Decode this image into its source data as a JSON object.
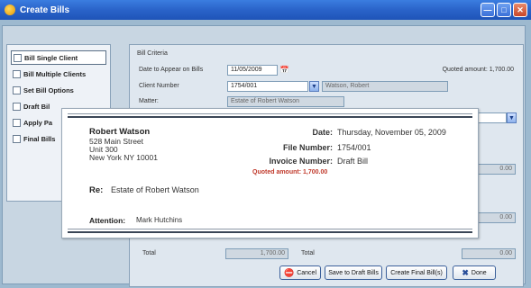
{
  "window": {
    "title": "Create Bills"
  },
  "nav": {
    "items": [
      {
        "label": "Bill Single Client",
        "active": true
      },
      {
        "label": "Bill Multiple Clients",
        "active": false
      },
      {
        "label": "Set Bill Options",
        "active": false
      },
      {
        "label": "Draft Bil",
        "active": false
      },
      {
        "label": "Apply Pa",
        "active": false
      },
      {
        "label": "Final Bills",
        "active": false
      }
    ]
  },
  "form": {
    "group_label": "Bill Criteria",
    "date_label": "Date to Appear on Bills",
    "date_value": "11/05/2009",
    "client_label": "Client Number",
    "client_value": "1754/001",
    "client_name": "Watson, Robert",
    "quoted_label": "Quoted amount:",
    "quoted_value": "1,700.00",
    "matter_label": "Matter:",
    "matter_value": "Estate of Robert Watson",
    "amount_1": "0.00",
    "amount_2": "0.00",
    "total_label_left": "Total",
    "total_value_left": "1,700.00",
    "total_label_right": "Total",
    "total_value_right": "0.00"
  },
  "buttons": {
    "cancel": "Cancel",
    "save_draft": "Save to Draft Bills",
    "create_final": "Create Final Bill(s)",
    "done": "Done"
  },
  "popup": {
    "name": "Robert Watson",
    "address_line1": "528 Main Street",
    "address_line2": "Unit 300",
    "address_line3": "New York NY 10001",
    "date_label": "Date:",
    "date_value": "Thursday, November 05, 2009",
    "file_label": "File Number:",
    "file_value": "1754/001",
    "invoice_label": "Invoice Number:",
    "invoice_value": "Draft Bill",
    "quoted": "Quoted amount: 1,700.00",
    "re_label": "Re:",
    "re_value": "Estate of Robert Watson",
    "attention_label": "Attention:",
    "attention_value": "Mark Hutchins"
  },
  "colors": {
    "title_bar": "#2a63c9",
    "quoted_text": "#c0392b",
    "client_bg": "#9db9cf"
  },
  "icons": {
    "app": "app-logo-icon",
    "calendar": "calendar-icon",
    "dropdown": "chevron-down-icon",
    "cancel": "cancel-icon",
    "done": "done-icon"
  }
}
